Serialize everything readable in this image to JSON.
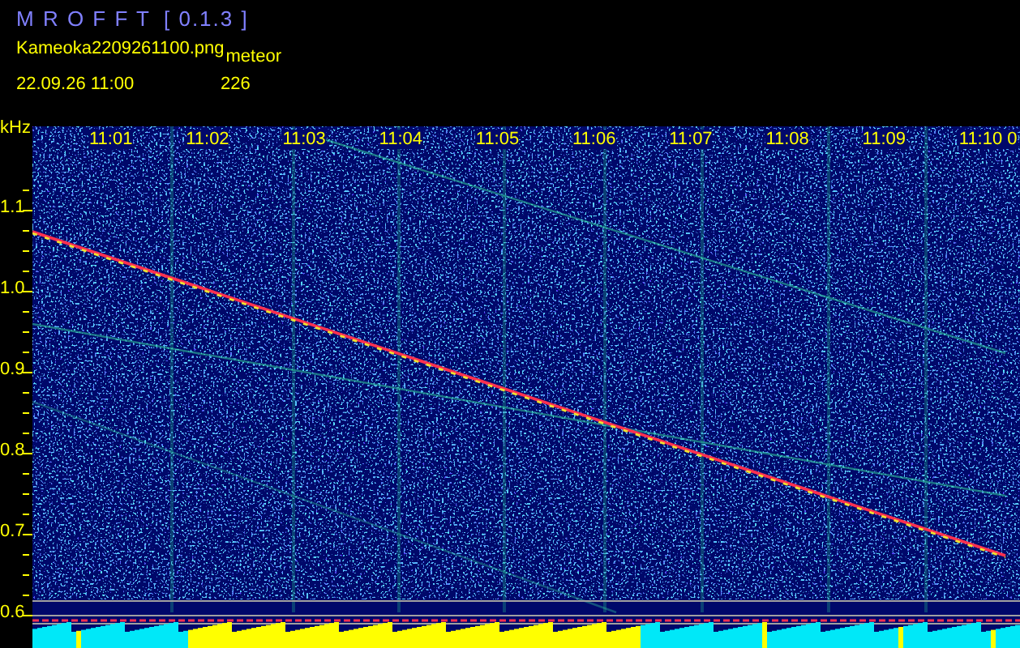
{
  "app": {
    "title": "M R O F F T",
    "version": "[ 0.1.3 ]"
  },
  "file_name": "Kameoka2209261100.png",
  "tag": "meteor",
  "datetime": "22.09.26 11:00",
  "count": "226",
  "spectrogram": {
    "unit": "kHz",
    "time_labels": [
      "11:01",
      "11:02",
      "11:03",
      "11:04",
      "11:05",
      "11:06",
      "11:07",
      "11:08",
      "11:09",
      "11:10 0"
    ],
    "freq_labels": [
      "1.1",
      "1.0",
      "0.9",
      "0.8",
      "0.7",
      "0.6"
    ]
  }
}
